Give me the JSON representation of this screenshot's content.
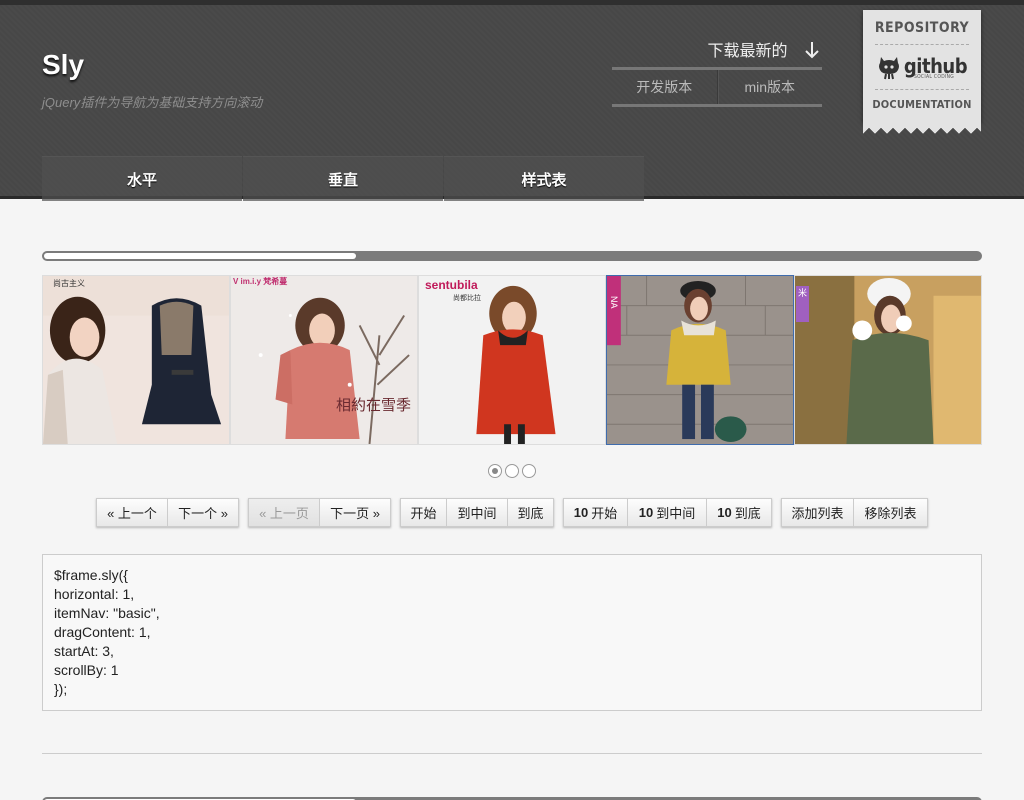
{
  "header": {
    "logo": "Sly",
    "tagline": "jQuery插件为导航为基础支持方向滚动",
    "download": {
      "title": "下载最新的",
      "links": [
        "开发版本",
        "min版本"
      ]
    },
    "ribbon": {
      "repository": "REPOSITORY",
      "github": "github",
      "github_sub": "SOCIAL CODING",
      "documentation": "DOCUMENTATION"
    },
    "nav": [
      "水平",
      "垂直",
      "样式表"
    ]
  },
  "scrollbar": {
    "position": 0.33
  },
  "slides": [
    {
      "brand": "尚古主义",
      "active": false
    },
    {
      "brand": "V im.i.y 梵希蔓",
      "caption": "相約在雪季",
      "active": false
    },
    {
      "brand": "sentubila",
      "brand_sub": "尚都比拉",
      "active": false
    },
    {
      "brand": "NA",
      "active": true
    },
    {
      "brand": "米",
      "active": false
    }
  ],
  "pages": {
    "count": 3,
    "active": 0
  },
  "controls": {
    "group1": [
      "« 上一个",
      "下一个 »"
    ],
    "group2": [
      "« 上一页",
      "下一页 »"
    ],
    "group3": [
      "开始",
      "到中间",
      "到底"
    ],
    "group4": [
      {
        "num": "10",
        "label": "开始"
      },
      {
        "num": "10",
        "label": "到中间"
      },
      {
        "num": "10",
        "label": "到底"
      }
    ],
    "group5": [
      "添加列表",
      "移除列表"
    ]
  },
  "code": {
    "lines": [
      "$frame.sly({",
      "horizontal: 1,",
      "itemNav: \"basic\",",
      "dragContent: 1,",
      "startAt: 3,",
      "scrollBy: 1",
      "});"
    ]
  }
}
